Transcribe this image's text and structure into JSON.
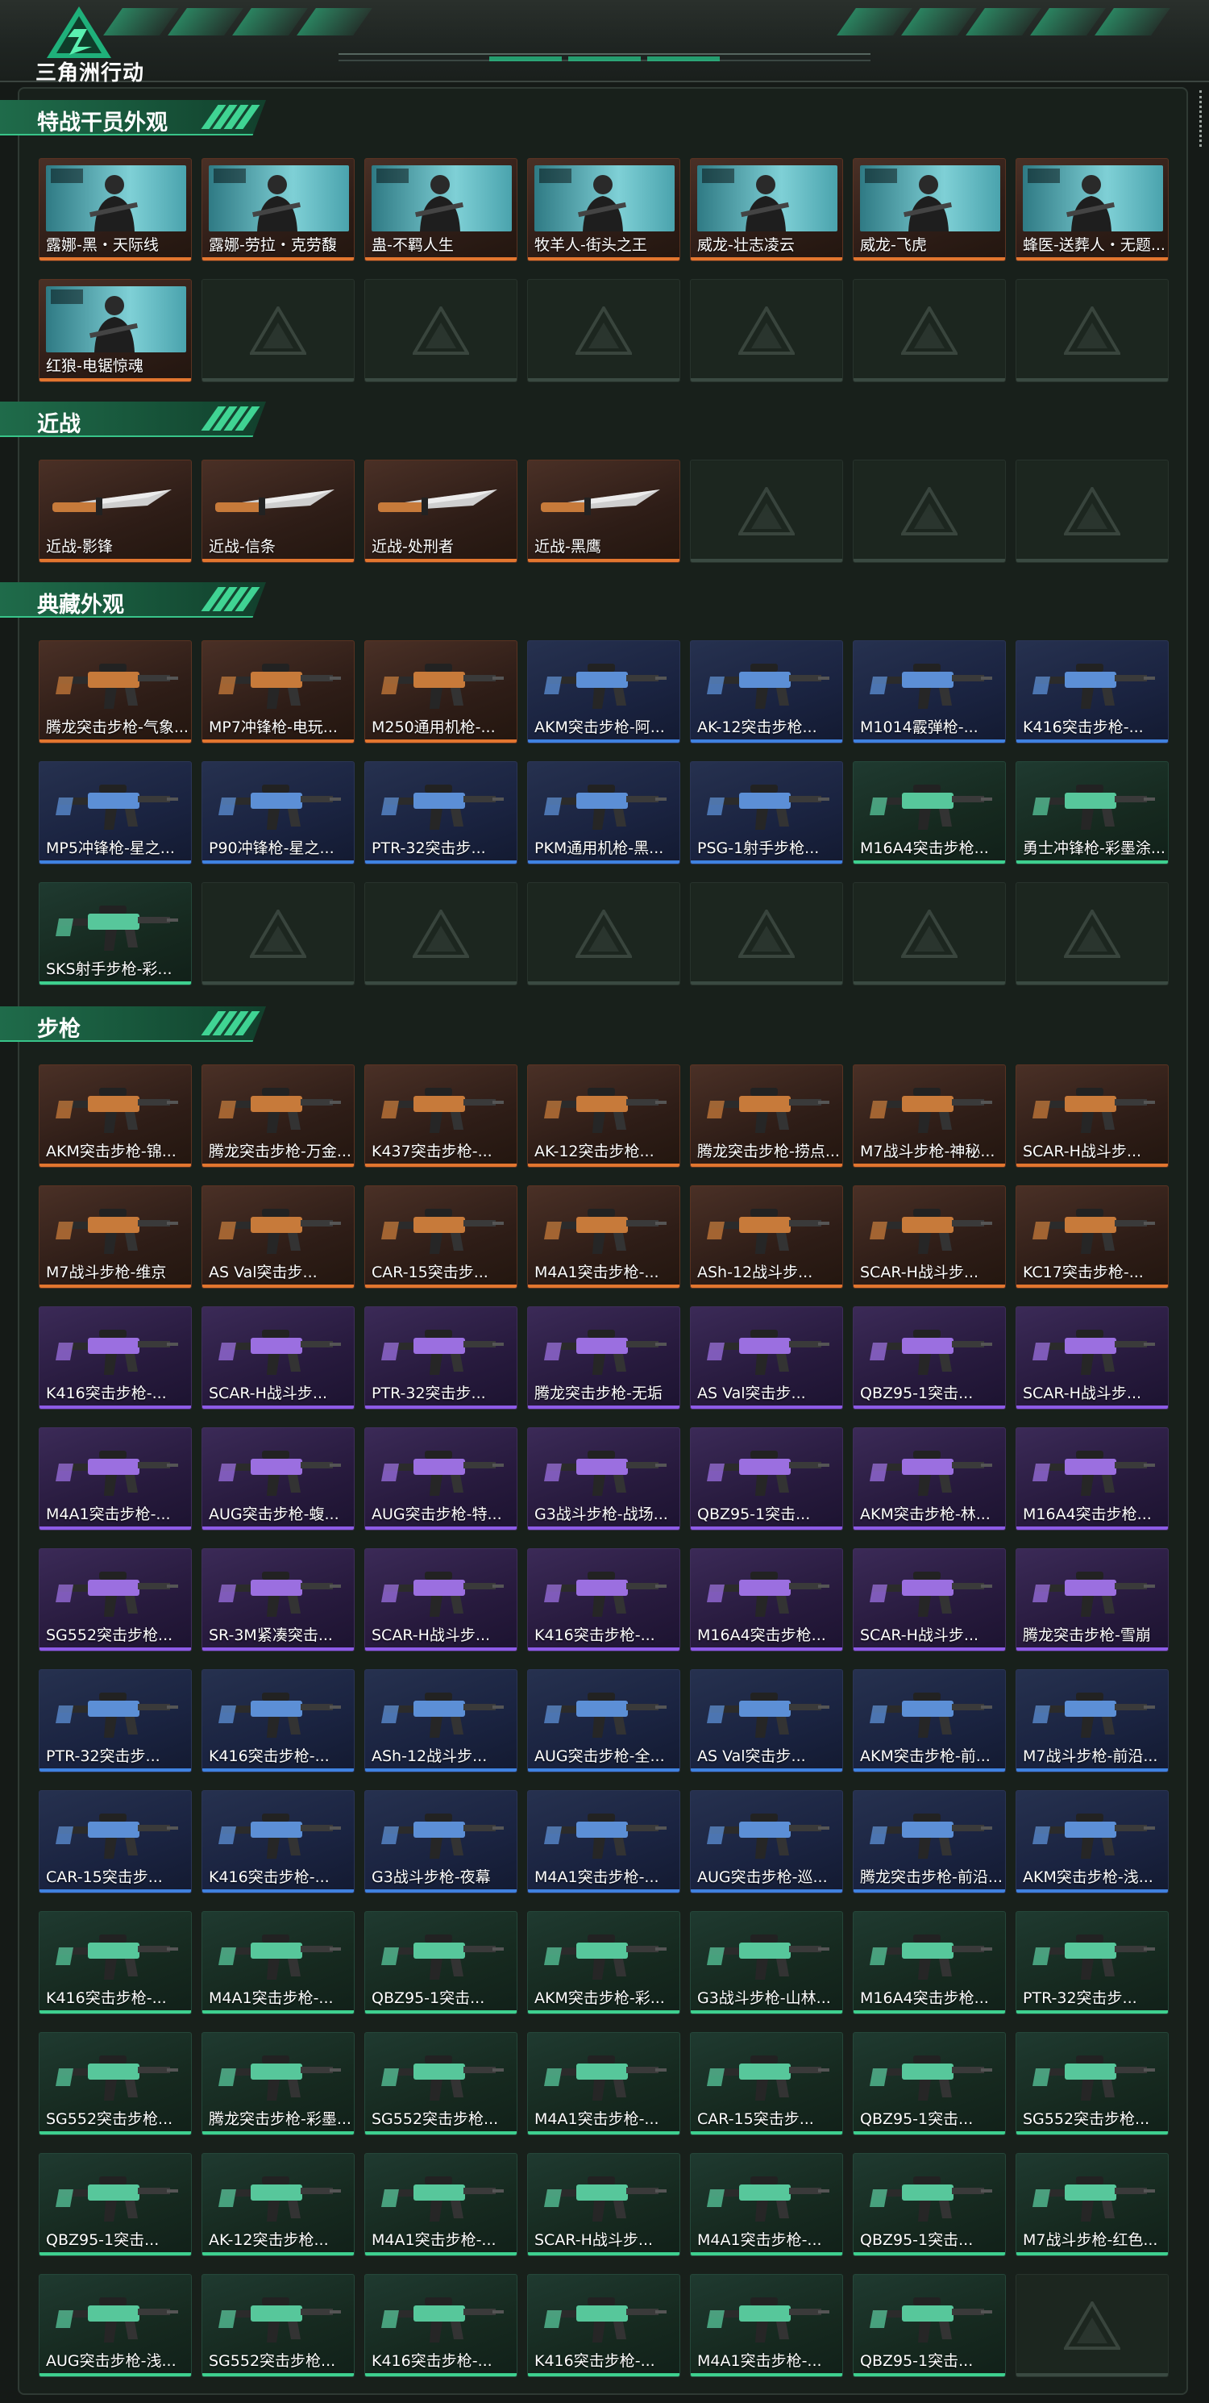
{
  "app": {
    "logo_text": "三角洲行动"
  },
  "sections": [
    {
      "title": "特战干员外观",
      "items": [
        {
          "label": "露娜-黑・天际线",
          "rarity": "orange"
        },
        {
          "label": "露娜-劳拉・克劳馥",
          "rarity": "orange"
        },
        {
          "label": "蛊-不羁人生",
          "rarity": "orange"
        },
        {
          "label": "牧羊人-街头之王",
          "rarity": "orange"
        },
        {
          "label": "威龙-壮志凌云",
          "rarity": "orange"
        },
        {
          "label": "威龙-飞虎",
          "rarity": "orange"
        },
        {
          "label": "蜂医-送葬人・无题...",
          "rarity": "orange"
        },
        {
          "label": "红狼-电锯惊魂",
          "rarity": "orange"
        },
        {
          "label": "",
          "rarity": "empty"
        },
        {
          "label": "",
          "rarity": "empty"
        },
        {
          "label": "",
          "rarity": "empty"
        },
        {
          "label": "",
          "rarity": "empty"
        },
        {
          "label": "",
          "rarity": "empty"
        },
        {
          "label": "",
          "rarity": "empty"
        }
      ]
    },
    {
      "title": "近战",
      "items": [
        {
          "label": "近战-影锋",
          "rarity": "orange"
        },
        {
          "label": "近战-信条",
          "rarity": "orange"
        },
        {
          "label": "近战-处刑者",
          "rarity": "orange"
        },
        {
          "label": "近战-黑鹰",
          "rarity": "orange"
        },
        {
          "label": "",
          "rarity": "empty"
        },
        {
          "label": "",
          "rarity": "empty"
        },
        {
          "label": "",
          "rarity": "empty"
        }
      ]
    },
    {
      "title": "典藏外观",
      "items": [
        {
          "label": "腾龙突击步枪-气象...",
          "rarity": "orange"
        },
        {
          "label": "MP7冲锋枪-电玩...",
          "rarity": "orange"
        },
        {
          "label": "M250通用机枪-...",
          "rarity": "orange"
        },
        {
          "label": "AKM突击步枪-阿...",
          "rarity": "blue"
        },
        {
          "label": "AK-12突击步枪...",
          "rarity": "blue"
        },
        {
          "label": "M1014霰弹枪-...",
          "rarity": "blue"
        },
        {
          "label": "K416突击步枪-...",
          "rarity": "blue"
        },
        {
          "label": "MP5冲锋枪-星之...",
          "rarity": "blue"
        },
        {
          "label": "P90冲锋枪-星之...",
          "rarity": "blue"
        },
        {
          "label": "PTR-32突击步...",
          "rarity": "blue"
        },
        {
          "label": "PKM通用机枪-黑...",
          "rarity": "blue"
        },
        {
          "label": "PSG-1射手步枪...",
          "rarity": "blue"
        },
        {
          "label": "M16A4突击步枪...",
          "rarity": "green"
        },
        {
          "label": "勇士冲锋枪-彩墨涂...",
          "rarity": "green"
        },
        {
          "label": "SKS射手步枪-彩...",
          "rarity": "green"
        },
        {
          "label": "",
          "rarity": "empty"
        },
        {
          "label": "",
          "rarity": "empty"
        },
        {
          "label": "",
          "rarity": "empty"
        },
        {
          "label": "",
          "rarity": "empty"
        },
        {
          "label": "",
          "rarity": "empty"
        },
        {
          "label": "",
          "rarity": "empty"
        }
      ]
    },
    {
      "title": "步枪",
      "items": [
        {
          "label": "AKM突击步枪-锦...",
          "rarity": "orange"
        },
        {
          "label": "腾龙突击步枪-万金...",
          "rarity": "orange"
        },
        {
          "label": "K437突击步枪-...",
          "rarity": "orange"
        },
        {
          "label": "AK-12突击步枪...",
          "rarity": "orange"
        },
        {
          "label": "腾龙突击步枪-捞点...",
          "rarity": "orange"
        },
        {
          "label": "M7战斗步枪-神秘...",
          "rarity": "orange"
        },
        {
          "label": "SCAR-H战斗步...",
          "rarity": "orange"
        },
        {
          "label": "M7战斗步枪-维京",
          "rarity": "orange"
        },
        {
          "label": "AS Val突击步...",
          "rarity": "orange"
        },
        {
          "label": "CAR-15突击步...",
          "rarity": "orange"
        },
        {
          "label": "M4A1突击步枪-...",
          "rarity": "orange"
        },
        {
          "label": "ASh-12战斗步...",
          "rarity": "orange"
        },
        {
          "label": "SCAR-H战斗步...",
          "rarity": "orange"
        },
        {
          "label": "KC17突击步枪-...",
          "rarity": "orange"
        },
        {
          "label": "K416突击步枪-...",
          "rarity": "purple"
        },
        {
          "label": "SCAR-H战斗步...",
          "rarity": "purple"
        },
        {
          "label": "PTR-32突击步...",
          "rarity": "purple"
        },
        {
          "label": "腾龙突击步枪-无垢",
          "rarity": "purple"
        },
        {
          "label": "AS Val突击步...",
          "rarity": "purple"
        },
        {
          "label": "QBZ95-1突击...",
          "rarity": "purple"
        },
        {
          "label": "SCAR-H战斗步...",
          "rarity": "purple"
        },
        {
          "label": "M4A1突击步枪-...",
          "rarity": "purple"
        },
        {
          "label": "AUG突击步枪-蝮...",
          "rarity": "purple"
        },
        {
          "label": "AUG突击步枪-特...",
          "rarity": "purple"
        },
        {
          "label": "G3战斗步枪-战场...",
          "rarity": "purple"
        },
        {
          "label": "QBZ95-1突击...",
          "rarity": "purple"
        },
        {
          "label": "AKM突击步枪-林...",
          "rarity": "purple"
        },
        {
          "label": "M16A4突击步枪...",
          "rarity": "purple"
        },
        {
          "label": "SG552突击步枪...",
          "rarity": "purple"
        },
        {
          "label": "SR-3M紧凑突击...",
          "rarity": "purple"
        },
        {
          "label": "SCAR-H战斗步...",
          "rarity": "purple"
        },
        {
          "label": "K416突击步枪-...",
          "rarity": "purple"
        },
        {
          "label": "M16A4突击步枪...",
          "rarity": "purple"
        },
        {
          "label": "SCAR-H战斗步...",
          "rarity": "purple"
        },
        {
          "label": "腾龙突击步枪-雪崩",
          "rarity": "purple"
        },
        {
          "label": "PTR-32突击步...",
          "rarity": "blue"
        },
        {
          "label": "K416突击步枪-...",
          "rarity": "blue"
        },
        {
          "label": "ASh-12战斗步...",
          "rarity": "blue"
        },
        {
          "label": "AUG突击步枪-全...",
          "rarity": "blue"
        },
        {
          "label": "AS Val突击步...",
          "rarity": "blue"
        },
        {
          "label": "AKM突击步枪-前...",
          "rarity": "blue"
        },
        {
          "label": "M7战斗步枪-前沿...",
          "rarity": "blue"
        },
        {
          "label": "CAR-15突击步...",
          "rarity": "blue"
        },
        {
          "label": "K416突击步枪-...",
          "rarity": "blue"
        },
        {
          "label": "G3战斗步枪-夜幕",
          "rarity": "blue"
        },
        {
          "label": "M4A1突击步枪-...",
          "rarity": "blue"
        },
        {
          "label": "AUG突击步枪-巡...",
          "rarity": "blue"
        },
        {
          "label": "腾龙突击步枪-前沿...",
          "rarity": "blue"
        },
        {
          "label": "AKM突击步枪-浅...",
          "rarity": "blue"
        },
        {
          "label": "K416突击步枪-...",
          "rarity": "green"
        },
        {
          "label": "M4A1突击步枪-...",
          "rarity": "green"
        },
        {
          "label": "QBZ95-1突击...",
          "rarity": "green"
        },
        {
          "label": "AKM突击步枪-彩...",
          "rarity": "green"
        },
        {
          "label": "G3战斗步枪-山林...",
          "rarity": "green"
        },
        {
          "label": "M16A4突击步枪...",
          "rarity": "green"
        },
        {
          "label": "PTR-32突击步...",
          "rarity": "green"
        },
        {
          "label": "SG552突击步枪...",
          "rarity": "green"
        },
        {
          "label": "腾龙突击步枪-彩墨...",
          "rarity": "green"
        },
        {
          "label": "SG552突击步枪...",
          "rarity": "green"
        },
        {
          "label": "M4A1突击步枪-...",
          "rarity": "green"
        },
        {
          "label": "CAR-15突击步...",
          "rarity": "green"
        },
        {
          "label": "QBZ95-1突击...",
          "rarity": "green"
        },
        {
          "label": "SG552突击步枪...",
          "rarity": "green"
        },
        {
          "label": "QBZ95-1突击...",
          "rarity": "green"
        },
        {
          "label": "AK-12突击步枪...",
          "rarity": "green"
        },
        {
          "label": "M4A1突击步枪-...",
          "rarity": "green"
        },
        {
          "label": "SCAR-H战斗步...",
          "rarity": "green"
        },
        {
          "label": "M4A1突击步枪-...",
          "rarity": "green"
        },
        {
          "label": "QBZ95-1突击...",
          "rarity": "green"
        },
        {
          "label": "M7战斗步枪-红色...",
          "rarity": "green"
        },
        {
          "label": "AUG突击步枪-浅...",
          "rarity": "green"
        },
        {
          "label": "SG552突击步枪...",
          "rarity": "green"
        },
        {
          "label": "K416突击步枪-...",
          "rarity": "green"
        },
        {
          "label": "K416突击步枪-...",
          "rarity": "green"
        },
        {
          "label": "M4A1突击步枪-...",
          "rarity": "green"
        },
        {
          "label": "QBZ95-1突击...",
          "rarity": "green"
        },
        {
          "label": "",
          "rarity": "empty"
        }
      ]
    }
  ],
  "colors": {
    "orange": "#e2762f",
    "purple": "#8d5be6",
    "blue": "#3f82e0",
    "green": "#3ed08f",
    "accent": "#28c68a"
  },
  "icons": {
    "logo": "delta-logo-icon",
    "placeholder": "delta-watermark-icon"
  }
}
